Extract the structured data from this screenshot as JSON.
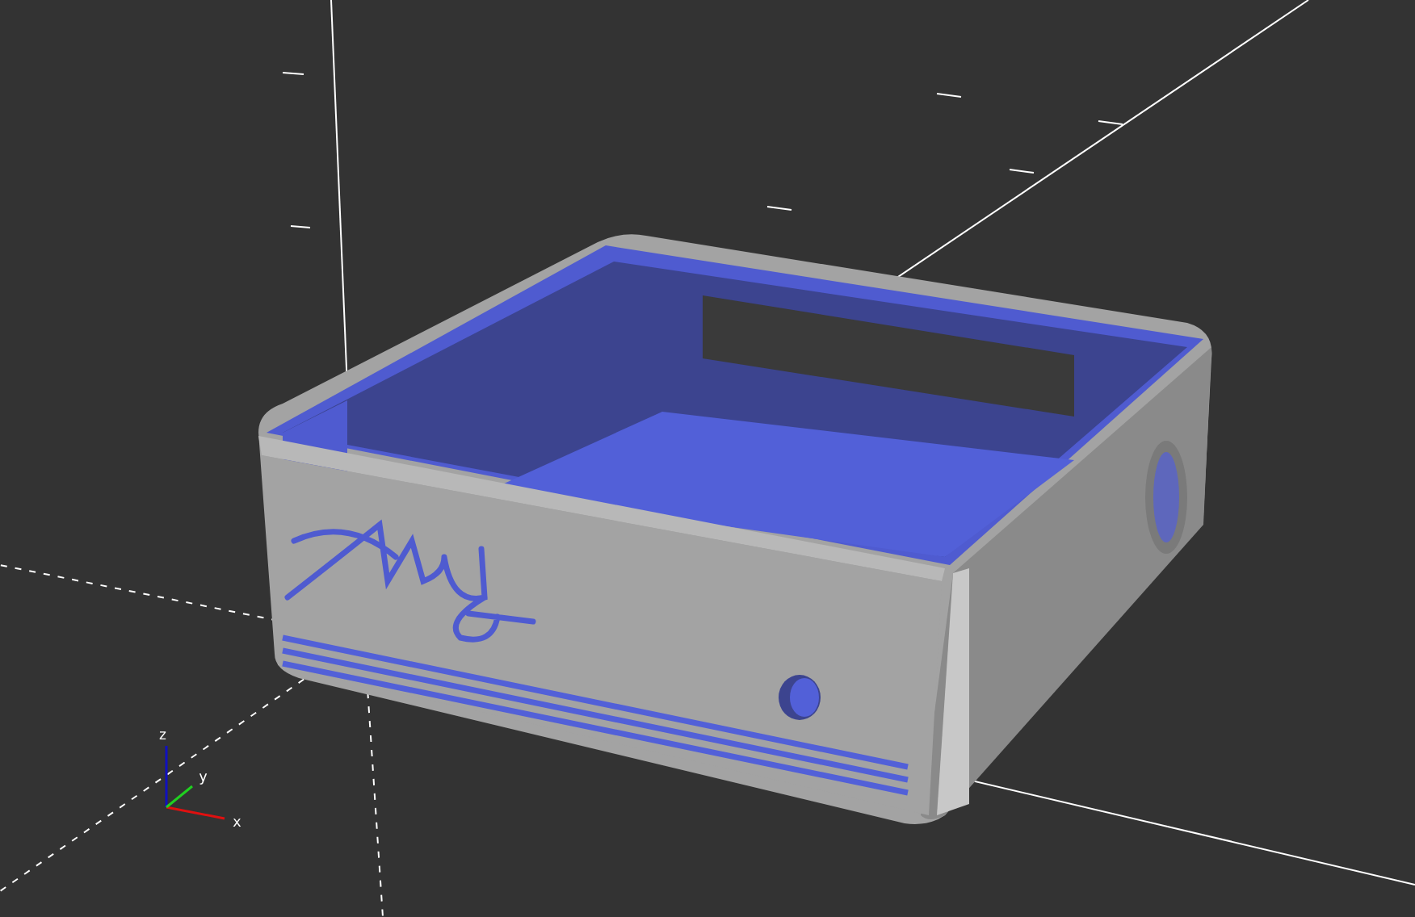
{
  "viewport": {
    "axis_labels": [
      "z",
      "y",
      "x"
    ]
  }
}
